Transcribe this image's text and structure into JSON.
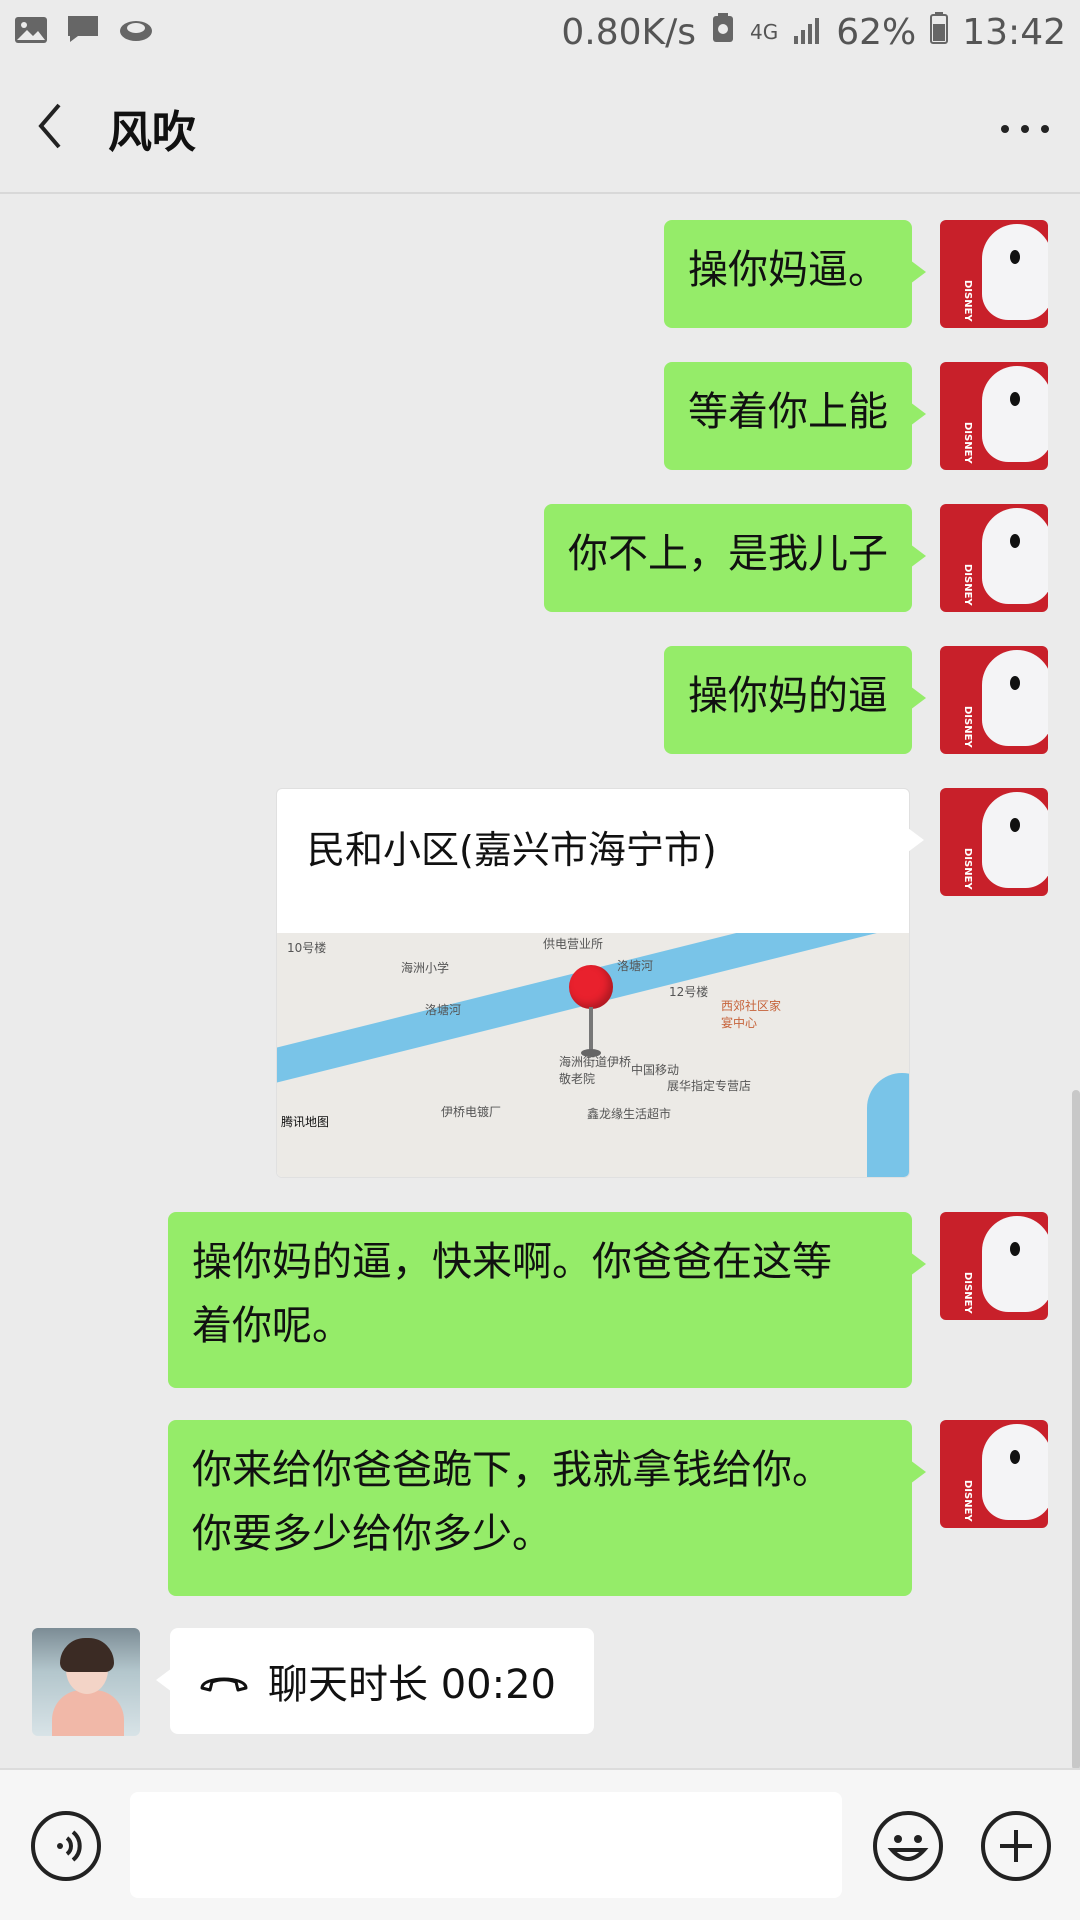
{
  "status_bar": {
    "speed": "0.80K/s",
    "network": "4G",
    "battery": "62%",
    "time": "13:42",
    "icons": [
      "image-icon",
      "message-icon",
      "cloud-icon",
      "recycle-icon",
      "signal-icon",
      "battery-icon"
    ]
  },
  "header": {
    "title": "风吹",
    "back_icon": "chevron-left-icon",
    "more_icon": "more-dots-icon"
  },
  "messages": [
    {
      "from": "me",
      "text": "操你妈逼。"
    },
    {
      "from": "me",
      "text": "等着你上能"
    },
    {
      "from": "me",
      "text": "你不上，是我儿子"
    },
    {
      "from": "me",
      "text": "操你妈的逼"
    },
    {
      "from": "me",
      "type": "location",
      "title": "民和小区(嘉兴市海宁市)"
    },
    {
      "from": "me",
      "lines": [
        "操你妈的逼，快来啊。你爸爸在这等",
        "着你呢。"
      ]
    },
    {
      "from": "me",
      "lines": [
        "你来给你爸爸跪下，我就拿钱给你。",
        "你要多少给你多少。"
      ]
    },
    {
      "from": "other",
      "type": "call",
      "text": "聊天时长 00:20"
    }
  ],
  "map": {
    "labels": {
      "a": "10号楼",
      "b": "供电营业所",
      "c": "海洲小学",
      "d": "洛塘河",
      "e": "洛塘河",
      "f": "12号楼",
      "g": "西郊社区家宴中心",
      "h": "海洲街道伊桥敬老院",
      "i": "中国移动",
      "j": "展华指定专营店",
      "k": "伊桥电镀厂",
      "l": "鑫龙缘生活超市",
      "m": "腾讯地图"
    }
  },
  "input": {
    "placeholder": "",
    "voice_icon": "voice-icon",
    "emoji_icon": "emoji-icon",
    "plus_icon": "plus-icon"
  },
  "colors": {
    "outgoing_bubble": "#95ec69",
    "background": "#ebebeb",
    "map_pin": "#e9212d"
  }
}
